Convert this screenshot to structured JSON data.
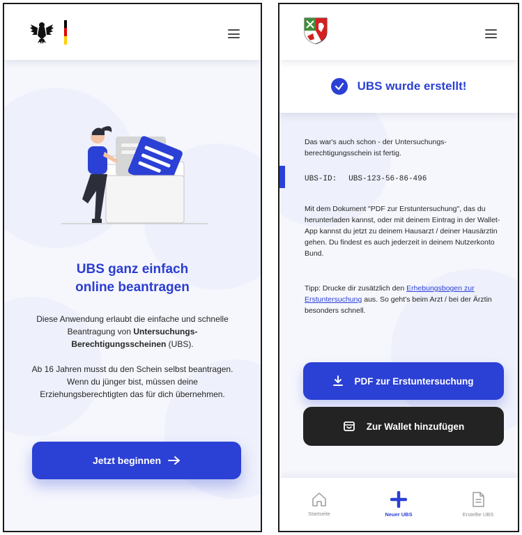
{
  "left": {
    "hero": {
      "title_line1": "UBS ganz einfach",
      "title_line2": "online beantragen",
      "p1_a": "Diese Anwendung erlaubt die einfache und schnelle Beantragung von ",
      "p1_bold": "Untersuchungs-Berechtigungsscheinen",
      "p1_b": " (UBS).",
      "p2": "Ab 16 Jahren musst du den Schein selbst beantragen. Wenn du jünger bist, müssen deine Erziehungsberechtigten das für dich übernehmen."
    },
    "start_button": {
      "label": "Jetzt beginnen",
      "icon": "arrow-right-icon"
    }
  },
  "right": {
    "success": {
      "label": "UBS wurde erstellt!",
      "icon": "check-circle-icon"
    },
    "intro": "Das war's auch schon - der Untersuchungs-berechtigungsschein ist fertig.",
    "ubs_id_label": "UBS-ID:",
    "ubs_id_value": "UBS-123-56-86-496",
    "info": "Mit dem Dokument \"PDF zur Erstuntersuchung\", das du herunterladen kannst, oder mit deinem Eintrag in der Wallet-App kannst du jetzt zu deinem Hausarzt / deiner Hausärztin gehen. Du findest es auch jederzeit in deinem Nutzerkonto Bund.",
    "tip_prefix": "Tipp: Drucke dir zusätzlich den ",
    "tip_link": "Erhebungsbogen zur Erstuntersuchung",
    "tip_suffix": " aus. So geht's beim Arzt / bei der Ärztin besonders schnell.",
    "pdf_button": {
      "label": "PDF zur Erstuntersuchung",
      "icon": "download-icon"
    },
    "wallet_button": {
      "label": "Zur Wallet hinzufügen",
      "icon": "wallet-icon"
    },
    "nav": [
      {
        "label": "Startseite",
        "icon": "home-icon",
        "active": false
      },
      {
        "label": "Neuer UBS",
        "icon": "plus-icon",
        "active": true
      },
      {
        "label": "Erstellte UBS",
        "icon": "document-icon",
        "active": false
      }
    ]
  },
  "colors": {
    "primary": "#2b40d4",
    "dark_button": "#232323",
    "background": "#f6f7fd"
  }
}
